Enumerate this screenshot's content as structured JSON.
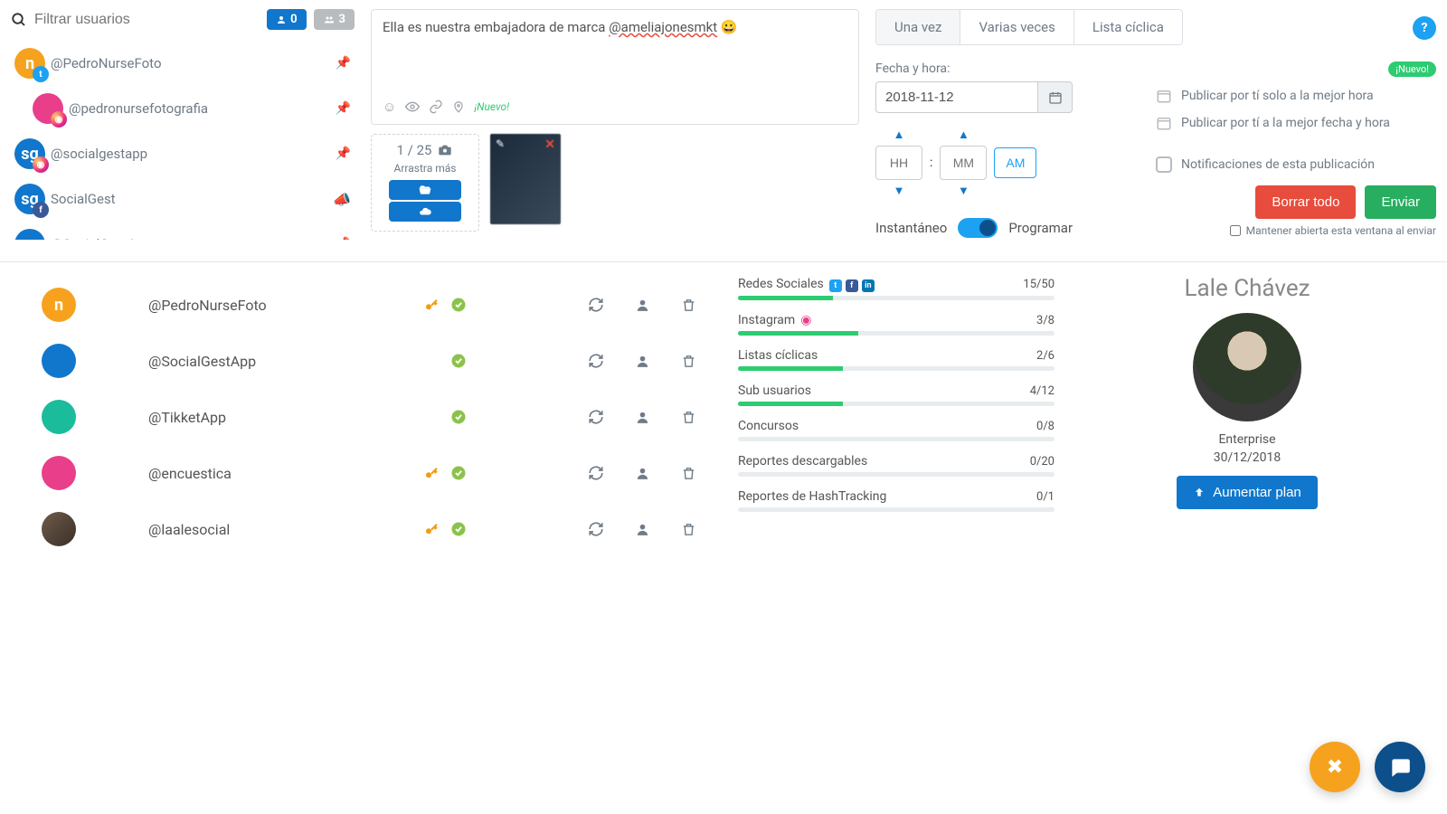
{
  "filter": {
    "placeholder": "Filtrar usuarios",
    "badge_users": "0",
    "badge_groups": "3"
  },
  "sidebar_users": [
    {
      "handle": "@PedroNurseFoto",
      "avatar": "n",
      "avatar_class": "av-orange",
      "net": "tw",
      "pin": true
    },
    {
      "handle": "@pedronursefotografia",
      "avatar": "",
      "avatar_class": "av-pink",
      "net": "ig",
      "pin": true,
      "indent": true
    },
    {
      "handle": "@socialgestapp",
      "avatar": "sg",
      "avatar_class": "av-blue",
      "net": "ig",
      "pin": true
    },
    {
      "handle": "SocialGest",
      "avatar": "sg",
      "avatar_class": "av-blue",
      "net": "fb",
      "horn": true
    },
    {
      "handle": "@SocialGestApp",
      "avatar": "sg",
      "avatar_class": "av-blue",
      "net": "tw",
      "pin": true
    }
  ],
  "compose": {
    "prefix": "Ella es nuestra embajadora de marca ",
    "mention": "@ameliajonesmkt",
    "emoji": "😀",
    "new_label": "¡Nuevo!",
    "media_count": "1 / 25",
    "media_drag": "Arrastra más"
  },
  "schedule": {
    "tabs": [
      "Una vez",
      "Varias veces",
      "Lista cíclica"
    ],
    "active_tab": 0,
    "date_label": "Fecha y hora:",
    "date_value": "2018-11-12",
    "hh_placeholder": "HH",
    "mm_placeholder": "MM",
    "ampm": "AM",
    "instant_label": "Instantáneo",
    "schedule_label": "Programar",
    "nuevo_badge": "¡Nuevo!",
    "opt_best_hour": "Publicar por tí solo a la mejor hora",
    "opt_best_datetime": "Publicar por tí a la mejor fecha y hora",
    "opt_notify": "Notificaciones de esta publicación",
    "btn_clear": "Borrar todo",
    "btn_send": "Enviar",
    "keep_open": "Mantener abierta esta ventana al enviar"
  },
  "accounts": [
    {
      "handle": "@PedroNurseFoto",
      "avatar_class": "aa-orange",
      "avatar_text": "n",
      "key": true,
      "check": true
    },
    {
      "handle": "@SocialGestApp",
      "avatar_class": "aa-blue",
      "avatar_text": "",
      "key": false,
      "check": true
    },
    {
      "handle": "@TikketApp",
      "avatar_class": "aa-teal",
      "avatar_text": "",
      "key": false,
      "check": true
    },
    {
      "handle": "@encuestica",
      "avatar_class": "aa-pink",
      "avatar_text": "",
      "key": true,
      "check": true
    },
    {
      "handle": "@laalesocial",
      "avatar_class": "aa-photo",
      "avatar_text": "",
      "key": true,
      "check": true
    }
  ],
  "usage": [
    {
      "label": "Redes Sociales",
      "icons": "tfl",
      "ratio": "15/50",
      "pct": 30
    },
    {
      "label": "Instagram",
      "icons": "ig",
      "ratio": "3/8",
      "pct": 38
    },
    {
      "label": "Listas cíclicas",
      "ratio": "2/6",
      "pct": 33
    },
    {
      "label": "Sub usuarios",
      "ratio": "4/12",
      "pct": 33
    },
    {
      "label": "Concursos",
      "ratio": "0/8",
      "pct": 0
    },
    {
      "label": "Reportes descargables",
      "ratio": "0/20",
      "pct": 0
    },
    {
      "label": "Reportes de HashTracking",
      "ratio": "0/1",
      "pct": 0
    }
  ],
  "profile": {
    "name": "Lale Chávez",
    "plan": "Enterprise",
    "renewal": "30/12/2018",
    "upgrade_label": "Aumentar plan"
  }
}
